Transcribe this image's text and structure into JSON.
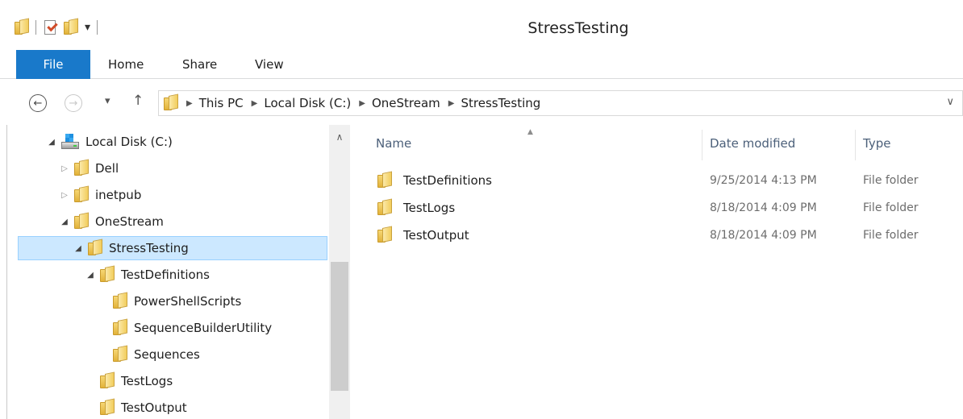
{
  "window": {
    "title": "StressTesting"
  },
  "ribbon": {
    "tabs": [
      {
        "label": "File"
      },
      {
        "label": "Home"
      },
      {
        "label": "Share"
      },
      {
        "label": "View"
      }
    ]
  },
  "address": {
    "crumbs": [
      "This PC",
      "Local Disk (C:)",
      "OneStream",
      "StressTesting"
    ]
  },
  "tree": {
    "items": [
      {
        "label": "Local Disk (C:)",
        "level": 0,
        "state": "expanded",
        "icon": "drive-icon"
      },
      {
        "label": "Dell",
        "level": 1,
        "state": "collapsed",
        "icon": "folder-icon"
      },
      {
        "label": "inetpub",
        "level": 1,
        "state": "collapsed",
        "icon": "folder-icon"
      },
      {
        "label": "OneStream",
        "level": 1,
        "state": "expanded",
        "icon": "folder-icon"
      },
      {
        "label": "StressTesting",
        "level": 2,
        "state": "expanded",
        "icon": "folder-icon",
        "selected": true
      },
      {
        "label": "TestDefinitions",
        "level": 3,
        "state": "expanded",
        "icon": "folder-icon"
      },
      {
        "label": "PowerShellScripts",
        "level": 4,
        "state": "none",
        "icon": "folder-icon"
      },
      {
        "label": "SequenceBuilderUtility",
        "level": 4,
        "state": "none",
        "icon": "folder-icon"
      },
      {
        "label": "Sequences",
        "level": 4,
        "state": "none",
        "icon": "folder-icon"
      },
      {
        "label": "TestLogs",
        "level": 3,
        "state": "none",
        "icon": "folder-icon"
      },
      {
        "label": "TestOutput",
        "level": 3,
        "state": "none",
        "icon": "folder-icon"
      }
    ]
  },
  "files": {
    "columns": [
      "Name",
      "Date modified",
      "Type"
    ],
    "rows": [
      {
        "name": "TestDefinitions",
        "date": "9/25/2014 4:13 PM",
        "type": "File folder"
      },
      {
        "name": "TestLogs",
        "date": "8/18/2014 4:09 PM",
        "type": "File folder"
      },
      {
        "name": "TestOutput",
        "date": "8/18/2014 4:09 PM",
        "type": "File folder"
      }
    ]
  },
  "colors": {
    "file_tab": "#1979ca",
    "selection_bg": "#cce8ff",
    "selection_border": "#99d1ff",
    "header_text": "#4c607a"
  }
}
